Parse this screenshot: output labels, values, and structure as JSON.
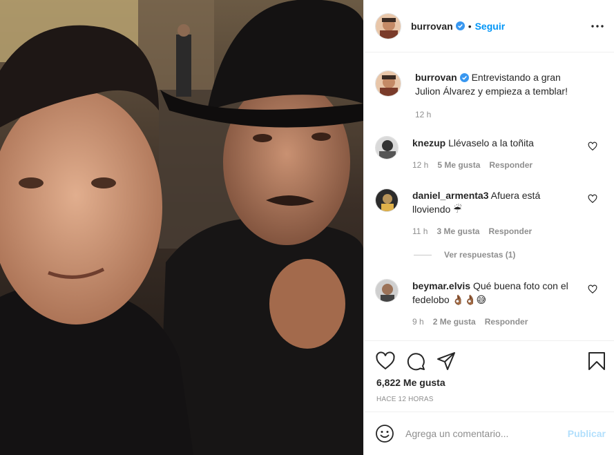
{
  "post": {
    "username": "burrovan",
    "follow_label": "Seguir",
    "separator": "•",
    "caption": "Entrevistando a gran Julion Álvarez y empieza a temblar!",
    "caption_time": "12 h"
  },
  "comments": [
    {
      "username": "knezup",
      "text": "Llévaselo a la toñita",
      "time": "12 h",
      "likes": "5 Me gusta",
      "reply": "Responder"
    },
    {
      "username": "daniel_armenta3",
      "text": "Afuera está lloviendo ☔",
      "time": "11 h",
      "likes": "3 Me gusta",
      "reply": "Responder",
      "view_replies": "Ver respuestas (1)"
    },
    {
      "username": "beymar.elvis",
      "text": "Qué buena foto con el fedelobo 👌🏾👌🏾😅",
      "time": "9 h",
      "likes": "2 Me gusta",
      "reply": "Responder"
    }
  ],
  "actions": {
    "like_count": "6,822 Me gusta",
    "time_ago": "HACE 12 HORAS"
  },
  "add_comment": {
    "placeholder": "Agrega un comentario...",
    "publish_label": "Publicar"
  },
  "colors": {
    "accent": "#0095f6",
    "publish_disabled": "#b2dffc",
    "muted": "#8e8e8e",
    "text": "#262626"
  },
  "icons": [
    "verified-badge-icon",
    "more-options-icon",
    "heart-icon",
    "comment-icon",
    "share-icon",
    "bookmark-icon",
    "emoji-icon"
  ]
}
